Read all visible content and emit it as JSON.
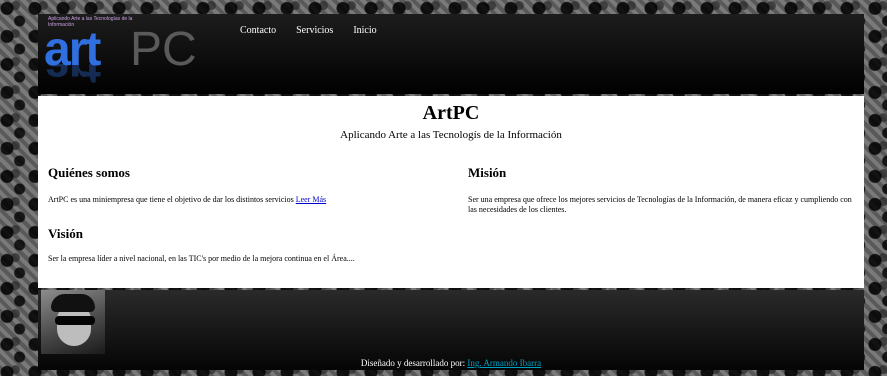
{
  "header": {
    "tagline_small": "Aplicando Arte a las Tecnologías de la Información",
    "logo_art": "art",
    "logo_pc": "PC",
    "nav": [
      "Contacto",
      "Servicios",
      "Inicio"
    ]
  },
  "hero": {
    "title": "ArtPC",
    "subtitle": "Aplicando Arte a las Tecnologís de la Información"
  },
  "sections": {
    "quienes": {
      "heading": "Quiénes somos",
      "text": "ArtPC es una miniempresa que tiene el objetivo de dar los distintos servicios",
      "link": "Leer Más"
    },
    "mision": {
      "heading": "Misión",
      "text": "Ser una empresa que ofrece los mejores servicios de Tecnologías de la Información, de manera eficaz y cumpliendo con las necesidades de los clientes."
    },
    "vision": {
      "heading": "Visión",
      "text": "Ser la empresa líder a nivel nacional, en las TIC's por medio de la mejora continua en el Área...."
    }
  },
  "footer": {
    "credit_label": "Diseñado y desarrollado por:",
    "credit_link": "Ing. Armando Ibarra"
  }
}
